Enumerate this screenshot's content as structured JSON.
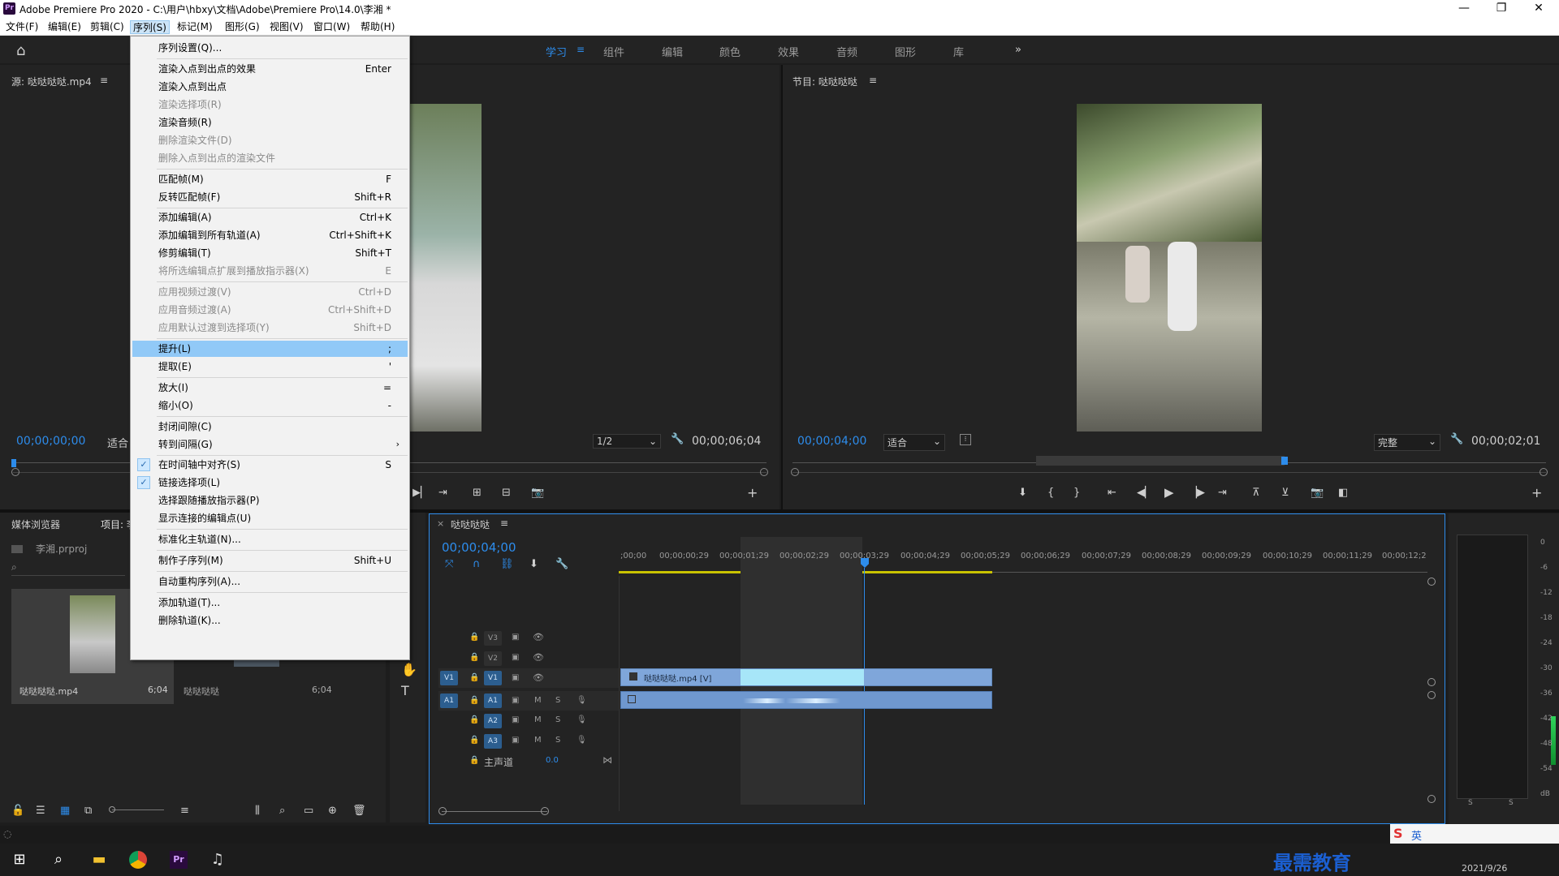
{
  "app": {
    "logo_text": "Pr",
    "title": "Adobe Premiere Pro 2020 - C:\\用户\\hbxy\\文档\\Adobe\\Premiere Pro\\14.0\\李湘 *"
  },
  "window_buttons": {
    "minimize": "—",
    "restore": "❐",
    "close": "✕"
  },
  "menubar": [
    {
      "label": "文件(F)"
    },
    {
      "label": "编辑(E)"
    },
    {
      "label": "剪辑(C)"
    },
    {
      "label": "序列(S)"
    },
    {
      "label": "标记(M)"
    },
    {
      "label": "图形(G)"
    },
    {
      "label": "视图(V)"
    },
    {
      "label": "窗口(W)"
    },
    {
      "label": "帮助(H)"
    }
  ],
  "workspaces": [
    "学习",
    "组件",
    "编辑",
    "颜色",
    "效果",
    "音频",
    "图形",
    "库"
  ],
  "workspace_more": "»",
  "source_panel": {
    "title": "源: 哒哒哒哒.mp4",
    "menu_icon": "≡",
    "timecode_left": "00;00;00;00",
    "fit_label": "适合",
    "resolution": "1/2",
    "timecode_right": "00;00;06;04"
  },
  "program_panel": {
    "title": "节目: 哒哒哒哒",
    "menu_icon": "≡",
    "timecode_left": "00;00;04;00",
    "fit_label": "适合",
    "quality": "完整",
    "timecode_right": "00;00;02;01"
  },
  "sequence_menu": {
    "items": [
      {
        "label": "序列设置(Q)...",
        "shortcut": "",
        "disabled": false
      },
      {
        "sep": true
      },
      {
        "label": "渲染入点到出点的效果",
        "shortcut": "Enter",
        "disabled": false
      },
      {
        "label": "渲染入点到出点",
        "shortcut": "",
        "disabled": false
      },
      {
        "label": "渲染选择项(R)",
        "shortcut": "",
        "disabled": true
      },
      {
        "label": "渲染音频(R)",
        "shortcut": "",
        "disabled": false
      },
      {
        "label": "删除渲染文件(D)",
        "shortcut": "",
        "disabled": true
      },
      {
        "label": "删除入点到出点的渲染文件",
        "shortcut": "",
        "disabled": true
      },
      {
        "sep": true
      },
      {
        "label": "匹配帧(M)",
        "shortcut": "F",
        "disabled": false
      },
      {
        "label": "反转匹配帧(F)",
        "shortcut": "Shift+R",
        "disabled": false
      },
      {
        "sep": true
      },
      {
        "label": "添加编辑(A)",
        "shortcut": "Ctrl+K",
        "disabled": false
      },
      {
        "label": "添加编辑到所有轨道(A)",
        "shortcut": "Ctrl+Shift+K",
        "disabled": false
      },
      {
        "label": "修剪编辑(T)",
        "shortcut": "Shift+T",
        "disabled": false
      },
      {
        "label": "将所选编辑点扩展到播放指示器(X)",
        "shortcut": "E",
        "disabled": true
      },
      {
        "sep": true
      },
      {
        "label": "应用视频过渡(V)",
        "shortcut": "Ctrl+D",
        "disabled": true
      },
      {
        "label": "应用音频过渡(A)",
        "shortcut": "Ctrl+Shift+D",
        "disabled": true
      },
      {
        "label": "应用默认过渡到选择项(Y)",
        "shortcut": "Shift+D",
        "disabled": true
      },
      {
        "sep": true
      },
      {
        "label": "提升(L)",
        "shortcut": ";",
        "disabled": false,
        "highlighted": true
      },
      {
        "label": "提取(E)",
        "shortcut": "'",
        "disabled": false
      },
      {
        "sep": true
      },
      {
        "label": "放大(I)",
        "shortcut": "=",
        "disabled": false
      },
      {
        "label": "缩小(O)",
        "shortcut": "-",
        "disabled": false
      },
      {
        "sep": true
      },
      {
        "label": "封闭间隙(C)",
        "shortcut": "",
        "disabled": false
      },
      {
        "label": "转到间隔(G)",
        "shortcut": "",
        "disabled": false,
        "submenu": true
      },
      {
        "sep": true
      },
      {
        "label": "在时间轴中对齐(S)",
        "shortcut": "S",
        "disabled": false,
        "checked": true
      },
      {
        "label": "链接选择项(L)",
        "shortcut": "",
        "disabled": false,
        "checked": true
      },
      {
        "label": "选择跟随播放指示器(P)",
        "shortcut": "",
        "disabled": false
      },
      {
        "label": "显示连接的编辑点(U)",
        "shortcut": "",
        "disabled": false
      },
      {
        "sep": true
      },
      {
        "label": "标准化主轨道(N)...",
        "shortcut": "",
        "disabled": false
      },
      {
        "sep": true
      },
      {
        "label": "制作子序列(M)",
        "shortcut": "Shift+U",
        "disabled": false
      },
      {
        "sep": true
      },
      {
        "label": "自动重构序列(A)...",
        "shortcut": "",
        "disabled": false
      },
      {
        "sep": true
      },
      {
        "label": "添加轨道(T)...",
        "shortcut": "",
        "disabled": false
      },
      {
        "label": "删除轨道(K)...",
        "shortcut": "",
        "disabled": false
      }
    ],
    "check_glyph": "✓",
    "submenu_glyph": "›"
  },
  "project_panel": {
    "tab_media": "媒体浏览器",
    "tab_project": "项目: 李",
    "file_name": "李湘.prproj",
    "items": [
      {
        "name": "哒哒哒哒.mp4",
        "duration": "6;04"
      },
      {
        "name": "哒哒哒哒",
        "duration": "6;04"
      }
    ]
  },
  "timeline": {
    "tab_title": "哒哒哒哒",
    "tab_close": "×",
    "menu_icon": "≡",
    "timecode": "00;00;04;00",
    "ruler": [
      ";00;00",
      "00;00;00;29",
      "00;00;01;29",
      "00;00;02;29",
      "00;00;03;29",
      "00;00;04;29",
      "00;00;05;29",
      "00;00;06;29",
      "00;00;07;29",
      "00;00;08;29",
      "00;00;09;29",
      "00;00;10;29",
      "00;00;11;29",
      "00;00;12;2"
    ],
    "tracks_video": [
      "V3",
      "V2",
      "V1"
    ],
    "tracks_audio": [
      "A1",
      "A2",
      "A3"
    ],
    "source_v": "V1",
    "source_a": "A1",
    "mute_label": "M",
    "solo_label": "S",
    "master_label": "主声道",
    "master_value": "0.0",
    "clip_video_name": "哒哒哒哒.mp4 [V]"
  },
  "audio_meter": {
    "scale": [
      "0",
      "-6",
      "-12",
      "-18",
      "-24",
      "-30",
      "-36",
      "-42",
      "-48",
      "-54",
      "dB"
    ],
    "solo_left": "S",
    "solo_right": "S"
  },
  "taskbar": {
    "start_icon": "⊞",
    "search_icon": "⌕",
    "date": "2021/9/26",
    "watermark": "最需教育",
    "ime_label": "英"
  },
  "colors": {
    "accent_blue": "#2d8ceb",
    "menu_highlight": "#91c9f7",
    "clip_video": "#7fa6da",
    "clip_selected": "#a7e6f8",
    "clip_audio": "#6f98cf"
  }
}
